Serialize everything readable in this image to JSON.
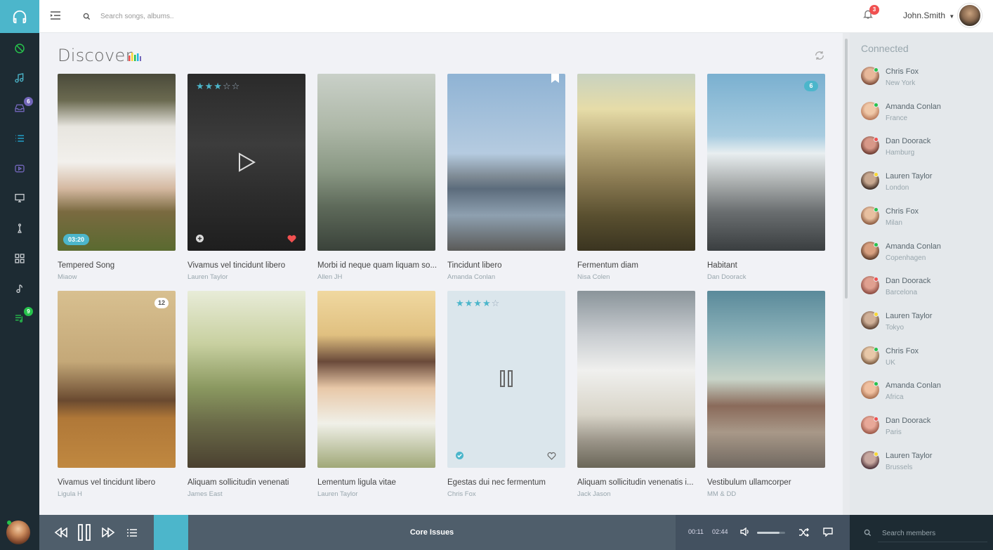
{
  "header": {
    "search_placeholder": "Search songs, albums..",
    "notification_count": "3",
    "username": "John.Smith"
  },
  "nav": {
    "inbox_badge": "6",
    "playlist_badge": "9"
  },
  "main": {
    "title": "Discover"
  },
  "cards": [
    {
      "title": "Tempered Song",
      "artist": "Miaow",
      "duration": "03:20"
    },
    {
      "title": "Vivamus vel tincidunt libero",
      "artist": "Lauren Taylor",
      "rating": 3
    },
    {
      "title": "Morbi id neque quam liquam so...",
      "artist": "Allen JH"
    },
    {
      "title": "Tincidunt libero",
      "artist": "Amanda Conlan"
    },
    {
      "title": "Fermentum diam",
      "artist": "Nisa Colen"
    },
    {
      "title": "Habitant",
      "artist": "Dan Doorack",
      "badge": "6"
    },
    {
      "title": "Vivamus vel tincidunt libero",
      "artist": "Ligula H",
      "badge": "12"
    },
    {
      "title": "Aliquam sollicitudin venenati",
      "artist": "James East"
    },
    {
      "title": "Lementum ligula vitae",
      "artist": "Lauren Taylor"
    },
    {
      "title": "Egestas dui nec fermentum",
      "artist": "Chris Fox",
      "rating": 4
    },
    {
      "title": "Aliquam sollicitudin venenatis i...",
      "artist": "Jack Jason"
    },
    {
      "title": "Vestibulum ullamcorper",
      "artist": "MM & DD"
    }
  ],
  "connected": {
    "title": "Connected",
    "members": [
      {
        "name": "Chris Fox",
        "location": "New York",
        "status": "online"
      },
      {
        "name": "Amanda Conlan",
        "location": "France",
        "status": "online"
      },
      {
        "name": "Dan Doorack",
        "location": "Hamburg",
        "status": "busy"
      },
      {
        "name": "Lauren Taylor",
        "location": "London",
        "status": "away"
      },
      {
        "name": "Chris Fox",
        "location": "Milan",
        "status": "online"
      },
      {
        "name": "Amanda Conlan",
        "location": "Copenhagen",
        "status": "online"
      },
      {
        "name": "Dan Doorack",
        "location": "Barcelona",
        "status": "busy"
      },
      {
        "name": "Lauren Taylor",
        "location": "Tokyo",
        "status": "away"
      },
      {
        "name": "Chris Fox",
        "location": "UK",
        "status": "online"
      },
      {
        "name": "Amanda Conlan",
        "location": "Africa",
        "status": "online"
      },
      {
        "name": "Dan Doorack",
        "location": "Paris",
        "status": "busy"
      },
      {
        "name": "Lauren Taylor",
        "location": "Brussels",
        "status": "away"
      }
    ]
  },
  "player": {
    "track_title": "Core Issues",
    "current_time": "00:11",
    "total_time": "02:44",
    "volume": 0.8,
    "search_placeholder": "Search members"
  },
  "colors": {
    "accent": "#4cb6cb",
    "nav_bg": "#1d2b33",
    "online": "#27c24c",
    "busy": "#f05050",
    "away": "#fad733"
  }
}
